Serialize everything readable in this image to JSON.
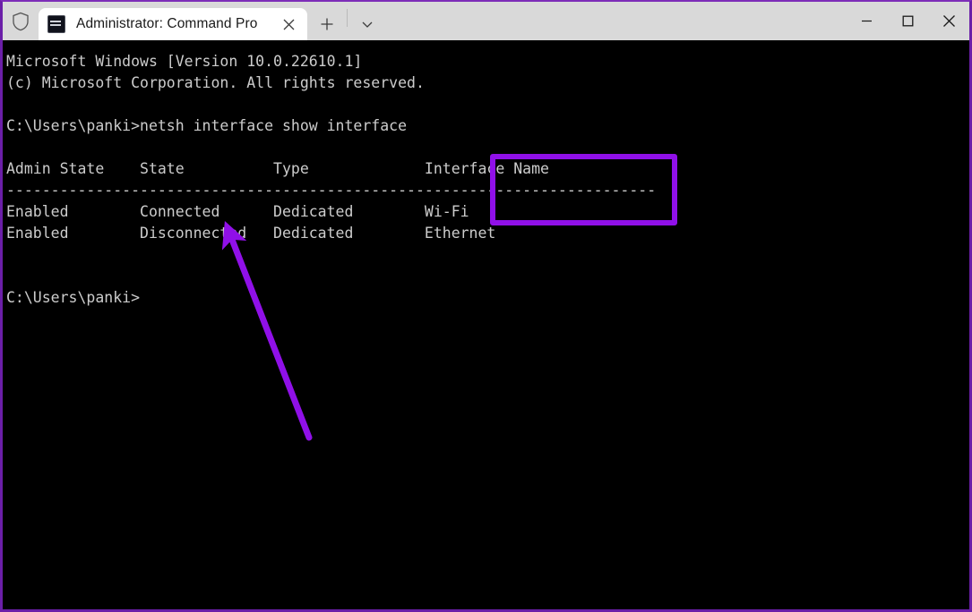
{
  "window": {
    "titlebar": {
      "shield_icon": "shield-icon",
      "tab": {
        "icon": "terminal-icon",
        "title": "Administrator: Command Pro",
        "close_icon": "close-icon"
      },
      "new_tab_icon": "plus-icon",
      "dropdown_icon": "chevron-down-icon",
      "minimize_icon": "minimize-icon",
      "maximize_icon": "maximize-icon",
      "close_icon": "close-icon"
    },
    "colors": {
      "window_border": "#6b1fa8",
      "titlebar_bg": "#d9d9d9",
      "tab_bg": "#ffffff",
      "terminal_bg": "#000000",
      "terminal_fg": "#cccccc",
      "annotation": "#9010e8"
    }
  },
  "terminal": {
    "lines": [
      "Microsoft Windows [Version 10.0.22610.1]",
      "(c) Microsoft Corporation. All rights reserved.",
      "",
      "C:\\Users\\panki>netsh interface show interface",
      "",
      "Admin State    State          Type             Interface Name",
      "-------------------------------------------------------------------------",
      "Enabled        Connected      Dedicated        Wi-Fi",
      "Enabled        Disconnected   Dedicated        Ethernet",
      "",
      "",
      "C:\\Users\\panki>"
    ],
    "command": "netsh interface show interface",
    "prompt": "C:\\Users\\panki>",
    "table": {
      "headers": [
        "Admin State",
        "State",
        "Type",
        "Interface Name"
      ],
      "rows": [
        [
          "Enabled",
          "Connected",
          "Dedicated",
          "Wi-Fi"
        ],
        [
          "Enabled",
          "Disconnected",
          "Dedicated",
          "Ethernet"
        ]
      ]
    }
  },
  "annotations": {
    "highlight_box_label": "interface-name-column-highlight",
    "arrow_label": "connected-state-arrow"
  }
}
